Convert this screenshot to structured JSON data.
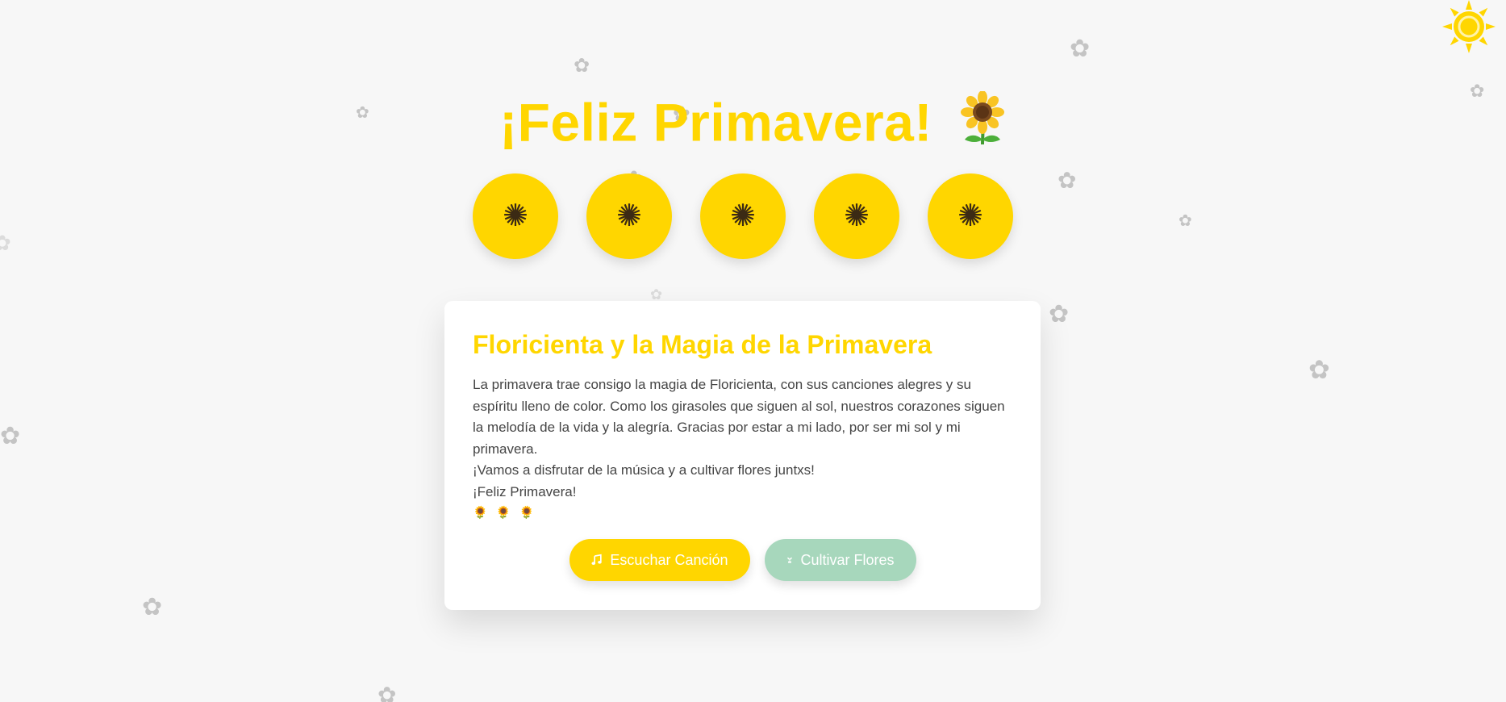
{
  "header": {
    "title": "¡Feliz Primavera!",
    "title_emoji": "sunflower-emoji"
  },
  "sunflower_buttons": [
    {
      "icon": "sunflower-icon",
      "glyph": "🌻"
    },
    {
      "icon": "sunflower-icon",
      "glyph": "🌻"
    },
    {
      "icon": "sunflower-icon",
      "glyph": "🌻"
    },
    {
      "icon": "sunflower-icon",
      "glyph": "🌻"
    },
    {
      "icon": "sunflower-icon",
      "glyph": "🌻"
    }
  ],
  "card": {
    "title": "Floricienta y la Magia de la Primavera",
    "paragraph": "La primavera trae consigo la magia de Floricienta, con sus canciones alegres y su espíritu lleno de color. Como los girasoles que siguen al sol, nuestros corazones siguen la melodía de la vida y la alegría. Gracias por estar a mi lado, por ser mi sol y mi primavera.",
    "line_2": "¡Vamos a disfrutar de la música y a cultivar flores juntxs!",
    "line_3": "¡Feliz Primavera!",
    "emoji_line": "🌻 🌻 🌻"
  },
  "actions": {
    "listen_label": "Escuchar Canción",
    "listen_icon": "music-note-icon",
    "grow_label": "Cultivar Flores",
    "grow_icon": "seedling-icon"
  },
  "decor": {
    "corner_icon": "sun-icon",
    "background_icon": "blossom-icon"
  },
  "colors": {
    "accent": "#ffd600",
    "secondary": "#a7d7bc",
    "background": "#f7f7f7",
    "card": "#ffffff",
    "text": "#454545"
  }
}
